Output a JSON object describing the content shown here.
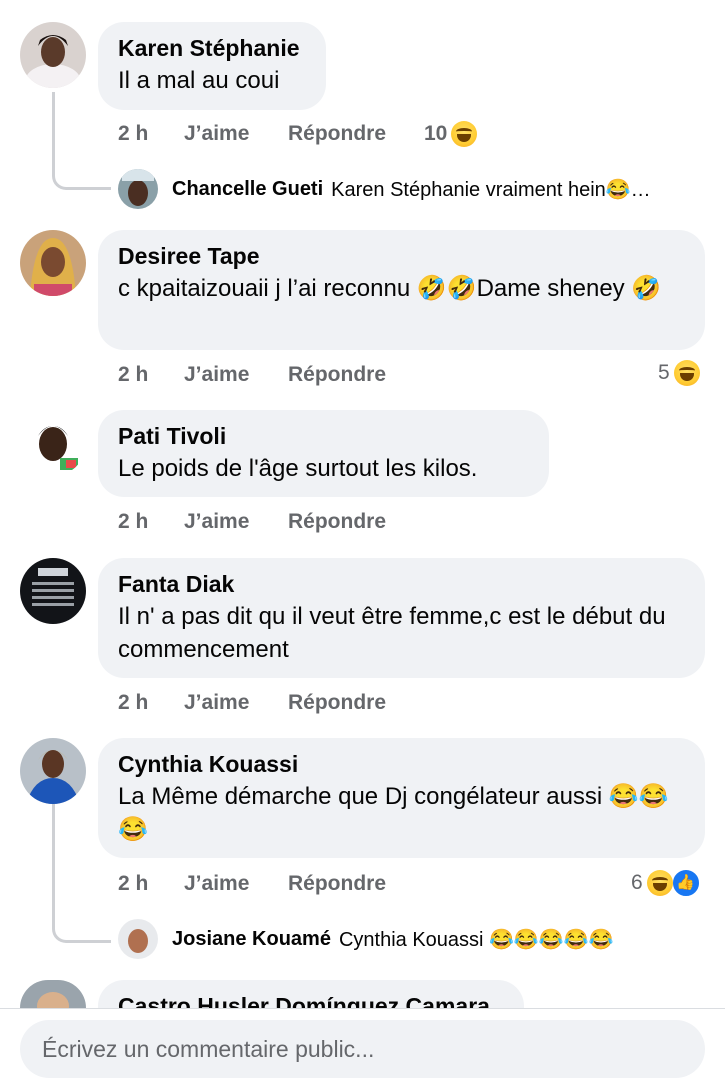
{
  "comments": [
    {
      "author": "Karen Stéphanie",
      "text": "Il a mal au coui",
      "time": "2 h",
      "like_label": "J’aime",
      "reply_label": "Répondre",
      "reaction_count": "10",
      "reply": {
        "author": "Chancelle Gueti",
        "text": "Karen Stéphanie vraiment hein😂…"
      }
    },
    {
      "author": "Desiree Tape",
      "text": "c kpaitaizouaii j l’ai reconnu 🤣🤣Dame sheney 🤣",
      "time": "2 h",
      "like_label": "J’aime",
      "reply_label": "Répondre",
      "reaction_count": "5"
    },
    {
      "author": "Pati Tivoli",
      "text": "Le poids de l'âge surtout les kilos.",
      "time": "2 h",
      "like_label": "J’aime",
      "reply_label": "Répondre"
    },
    {
      "author": "Fanta Diak",
      "text": "Il n' a pas dit qu il veut être femme,c est le début du commencement",
      "time": "2 h",
      "like_label": "J’aime",
      "reply_label": "Répondre"
    },
    {
      "author": "Cynthia Kouassi",
      "text": "La Même démarche que Dj congélateur aussi 😂😂😂",
      "time": "2 h",
      "like_label": "J’aime",
      "reply_label": "Répondre",
      "reaction_count": "6",
      "reply": {
        "author": "Josiane Kouamé",
        "text": "Cynthia Kouassi 😂😂😂😂😂"
      }
    },
    {
      "author": "Castro Husler Domínguez Camara"
    }
  ],
  "composer": {
    "placeholder": "Écrivez un commentaire public..."
  },
  "icons": {
    "reaction_haha": "laughing-face-icon",
    "reaction_like": "thumbs-up-icon"
  },
  "colors": {
    "bubble": "#f0f2f5",
    "meta_text": "#65676b",
    "like_blue": "#1877f2"
  }
}
